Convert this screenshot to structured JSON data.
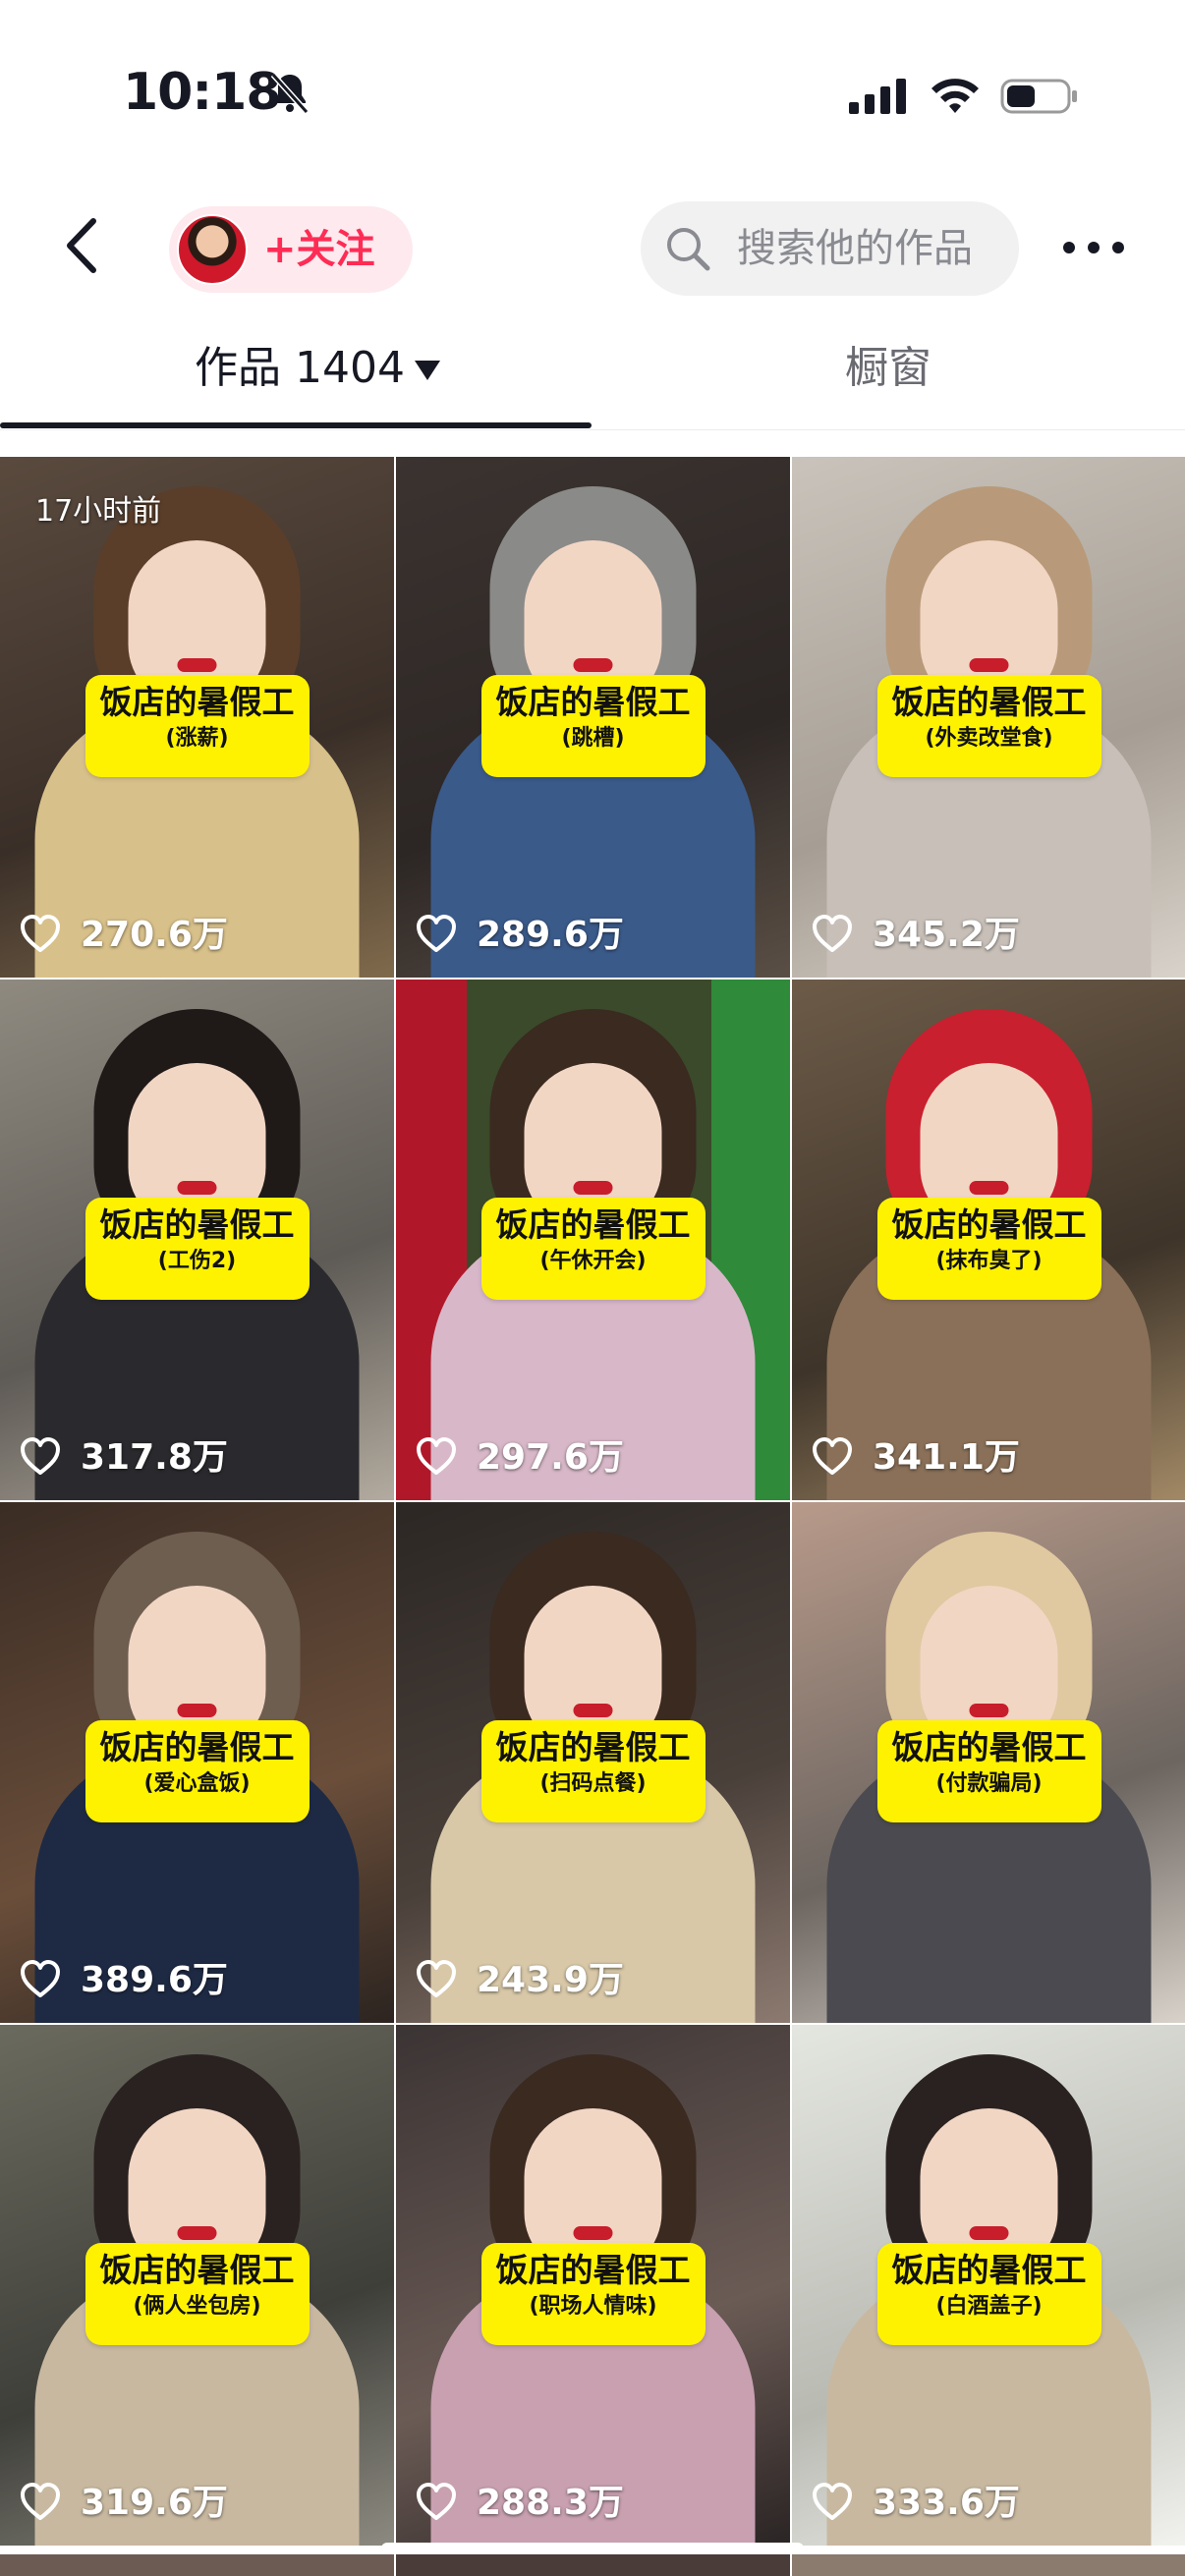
{
  "status_bar": {
    "time": "10:18",
    "bell_icon": "bell-slash-icon",
    "signal_icon": "cellular-signal-icon",
    "wifi_icon": "wifi-icon",
    "battery_icon": "battery-icon"
  },
  "header": {
    "back_icon": "chevron-left-icon",
    "follow_label": "+关注",
    "search_placeholder": "搜索他的作品",
    "more_icon": "more-horizontal-icon"
  },
  "tabs": [
    {
      "label": "作品",
      "count": "1404",
      "active": true
    },
    {
      "label": "橱窗",
      "active": false
    }
  ],
  "videos": [
    {
      "title": "饭店的暑假工",
      "subtitle": "(涨薪)",
      "likes": "270.6万",
      "time": "17小时前"
    },
    {
      "title": "饭店的暑假工",
      "subtitle": "(跳槽)",
      "likes": "289.6万"
    },
    {
      "title": "饭店的暑假工",
      "subtitle": "(外卖改堂食)",
      "likes": "345.2万"
    },
    {
      "title": "饭店的暑假工",
      "subtitle": "(工伤2)",
      "likes": "317.8万"
    },
    {
      "title": "饭店的暑假工",
      "subtitle": "(午休开会)",
      "likes": "297.6万"
    },
    {
      "title": "饭店的暑假工",
      "subtitle": "(抹布臭了)",
      "likes": "341.1万"
    },
    {
      "title": "饭店的暑假工",
      "subtitle": "(爱心盒饭)",
      "likes": "389.6万"
    },
    {
      "title": "饭店的暑假工",
      "subtitle": "(扫码点餐)",
      "likes": "243.9万"
    },
    {
      "title": "饭店的暑假工",
      "subtitle": "(付款骗局)",
      "likes": ""
    },
    {
      "title": "饭店的暑假工",
      "subtitle": "(俩人坐包房)",
      "likes": "319.6万"
    },
    {
      "title": "饭店的暑假工",
      "subtitle": "(职场人情味)",
      "likes": "288.3万"
    },
    {
      "title": "饭店的暑假工",
      "subtitle": "(白酒盖子)",
      "likes": "333.6万"
    }
  ],
  "colors": {
    "accent": "#fe2c55",
    "card_yellow": "#fff200",
    "text_primary": "#161823",
    "text_secondary": "#6a6b72"
  }
}
